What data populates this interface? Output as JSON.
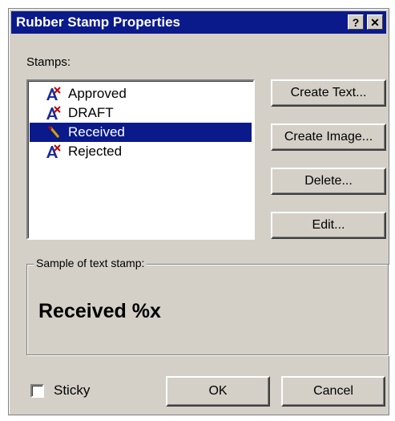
{
  "dialog": {
    "title": "Rubber Stamp Properties",
    "help_button": "?",
    "close_button": "✕"
  },
  "stamps": {
    "label": "Stamps:",
    "items": [
      {
        "label": "Approved",
        "icon": "text-stamp-icon",
        "selected": false
      },
      {
        "label": "DRAFT",
        "icon": "text-stamp-icon",
        "selected": false
      },
      {
        "label": "Received",
        "icon": "image-stamp-icon",
        "selected": true
      },
      {
        "label": "Rejected",
        "icon": "text-stamp-icon",
        "selected": false
      }
    ]
  },
  "buttons": {
    "create_text": "Create Text...",
    "create_image": "Create Image...",
    "delete": "Delete...",
    "edit": "Edit...",
    "ok": "OK",
    "cancel": "Cancel"
  },
  "sample": {
    "legend": "Sample of text stamp:",
    "text": "Received %x"
  },
  "sticky": {
    "label": "Sticky",
    "checked": false
  },
  "colors": {
    "dialog_bg": "#d4d0c8",
    "titlebar_bg": "#0a1a8a",
    "selection_bg": "#0a1a8a"
  }
}
